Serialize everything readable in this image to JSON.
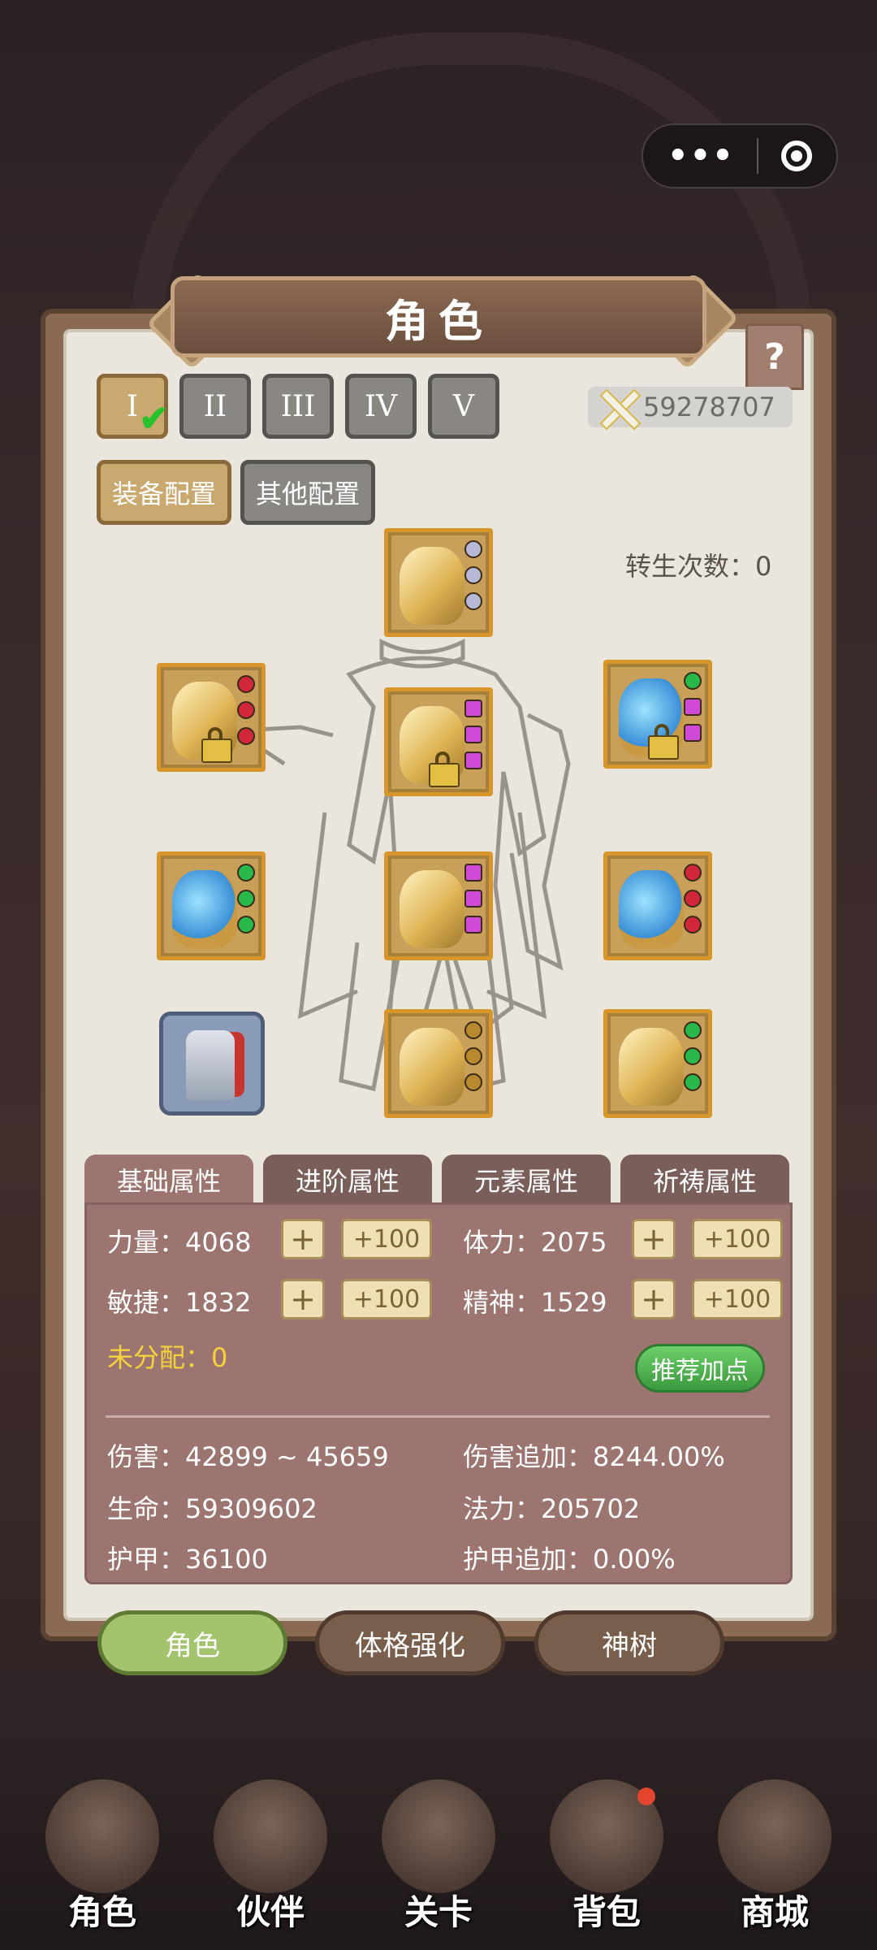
{
  "miniprogram": {
    "more_icon": "more-dots-icon",
    "close_icon": "target-circle-icon"
  },
  "panel": {
    "title": "角色",
    "help": "?"
  },
  "presets": [
    "I",
    "II",
    "III",
    "IV",
    "V"
  ],
  "power": {
    "value": "59278707"
  },
  "config": {
    "equipment": "装备配置",
    "other": "其他配置"
  },
  "rebirth": {
    "label": "转生次数：0"
  },
  "attr_tabs": [
    "基础属性",
    "进阶属性",
    "元素属性",
    "祈祷属性"
  ],
  "attributes": {
    "strength": "力量：4068",
    "stamina": "体力：2075",
    "agility": "敏捷：1832",
    "spirit": "精神：1529",
    "plus": "+",
    "plus100": "+100",
    "unallocated": "未分配：0",
    "recommend": "推荐加点",
    "damage": "伤害：42899 ~ 45659",
    "damage_bonus": "伤害追加：8244.00%",
    "life": "生命：59309602",
    "mana": "法力：205702",
    "armor": "护甲：36100",
    "armor_bonus": "护甲追加：0.00%"
  },
  "sub_tabs": [
    "角色",
    "体格强化",
    "神树"
  ],
  "nav": [
    "角色",
    "伙伴",
    "关卡",
    "背包",
    "商城"
  ],
  "colors": {
    "accent_gold": "#c9a96f",
    "panel_brown": "#9c7470",
    "active_green": "#a3c46d",
    "highlight_yellow": "#f5d23c"
  }
}
